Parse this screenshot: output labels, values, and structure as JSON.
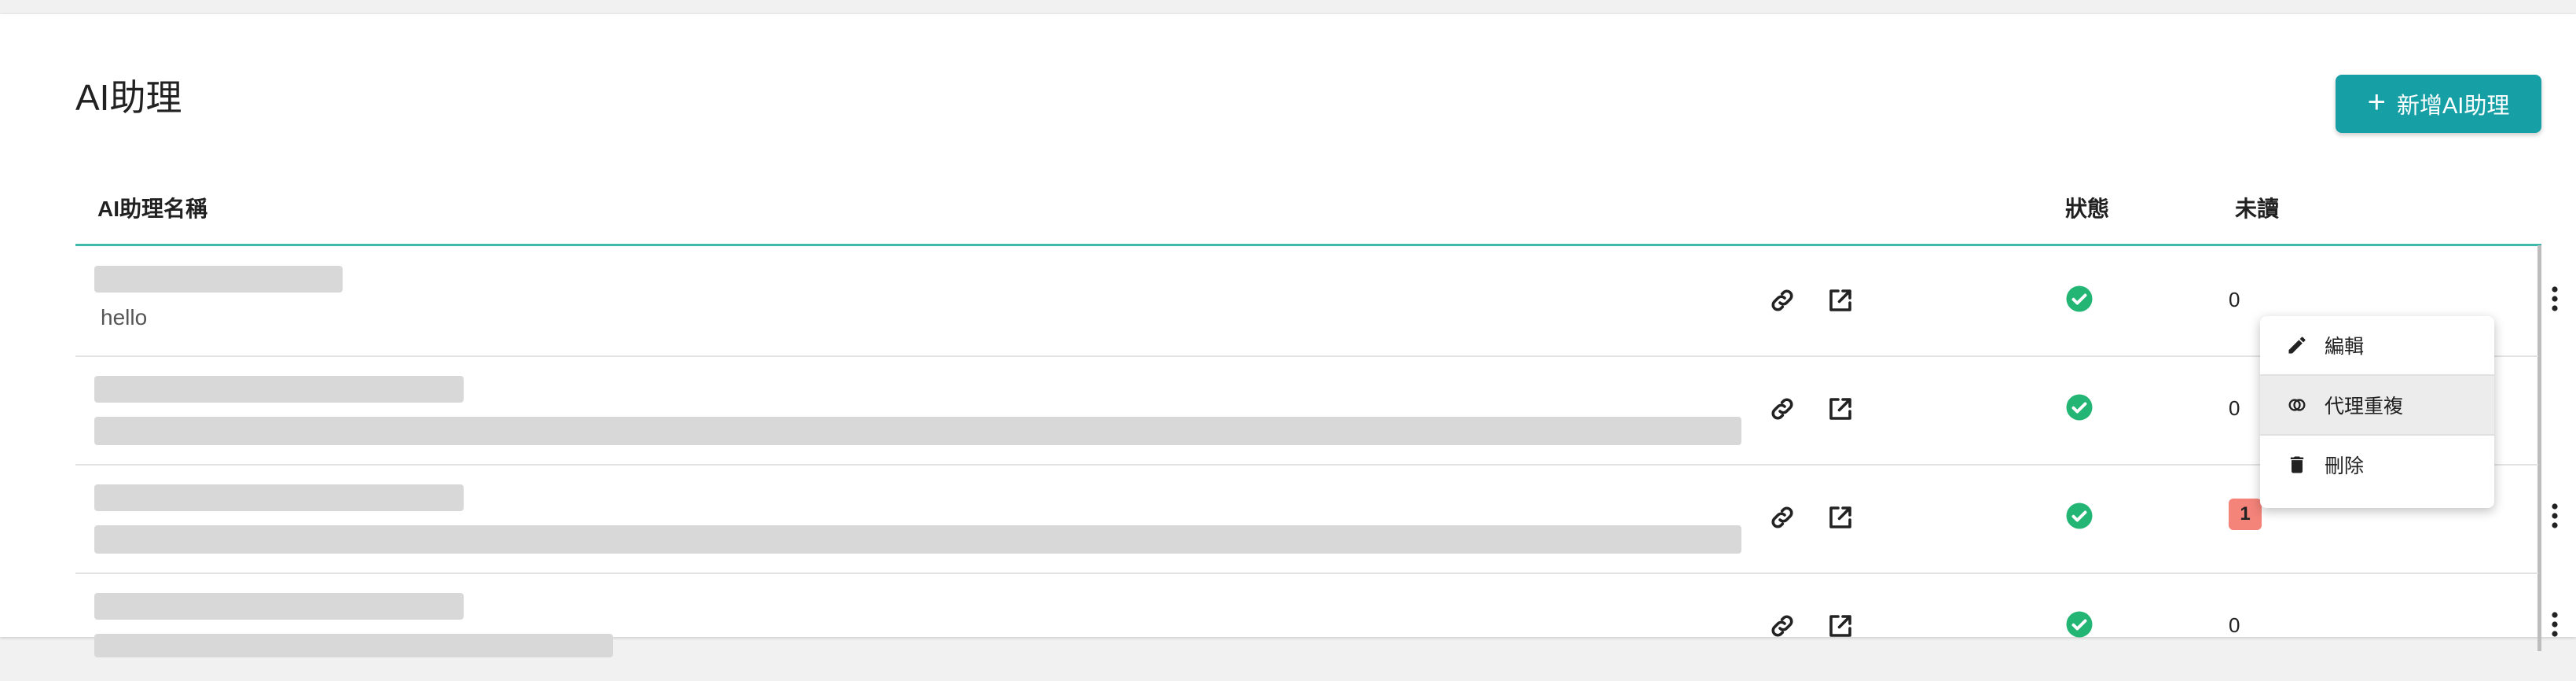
{
  "page": {
    "title": "AI助理"
  },
  "toolbar": {
    "add_label": "新增AI助理",
    "add_icon": "plus-icon"
  },
  "table": {
    "headers": {
      "name": "AI助理名稱",
      "status": "狀態",
      "unread": "未讀"
    },
    "rows": [
      {
        "description": "hello",
        "status": "active",
        "unread": "0"
      },
      {
        "description": "",
        "status": "active",
        "unread": "0"
      },
      {
        "description": "",
        "status": "active",
        "unread": "1",
        "unread_highlight": true
      },
      {
        "description": "",
        "status": "active",
        "unread": "0"
      }
    ]
  },
  "row_menu": {
    "items": [
      {
        "label": "編輯",
        "icon": "pencil-icon"
      },
      {
        "label": "代理重複",
        "icon": "duplicate-icon",
        "hovered": true
      },
      {
        "label": "刪除",
        "icon": "trash-icon"
      }
    ]
  },
  "colors": {
    "accent": "#16a0a6",
    "status_ok": "#22b573",
    "badge": "#f4837a"
  }
}
